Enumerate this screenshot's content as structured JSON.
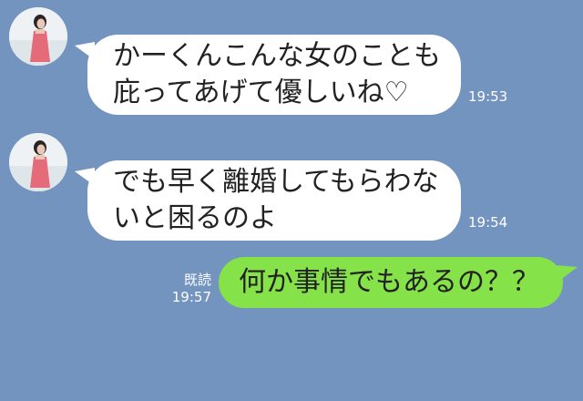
{
  "colors": {
    "background": "#7494c0",
    "incoming_bubble": "#ffffff",
    "outgoing_bubble": "#85e249",
    "meta_text": "#ffffff"
  },
  "messages": [
    {
      "direction": "incoming",
      "avatar": "user-avatar-icon",
      "text": "かーくんこんな女のことも\n庇ってあげて優しいね♡",
      "time": "19:53"
    },
    {
      "direction": "incoming",
      "avatar": "user-avatar-icon",
      "text": "でも早く離婚してもらわな\nいと困るのよ",
      "time": "19:54"
    },
    {
      "direction": "outgoing",
      "text": "何か事情でもあるの？？",
      "read_label": "既読",
      "time": "19:57"
    }
  ]
}
